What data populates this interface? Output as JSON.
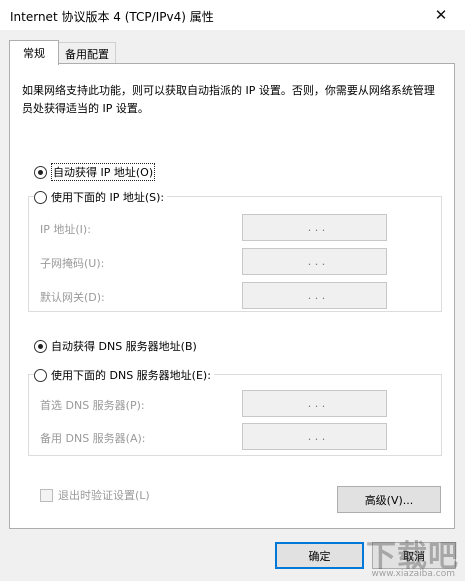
{
  "window": {
    "title": "Internet 协议版本 4 (TCP/IPv4) 属性",
    "close_glyph": "✕"
  },
  "tabs": [
    {
      "label": "常规",
      "active": true
    },
    {
      "label": "备用配置",
      "active": false
    }
  ],
  "description": "如果网络支持此功能，则可以获取自动指派的 IP 设置。否则，你需要从网络系统管理员处获得适当的 IP 设置。",
  "ip_section": {
    "auto_label": "自动获得 IP 地址(O)",
    "auto_checked": true,
    "manual_label": "使用下面的 IP 地址(S):",
    "manual_checked": false,
    "fields": [
      {
        "label": "IP 地址(I):",
        "value": ". . ."
      },
      {
        "label": "子网掩码(U):",
        "value": ". . ."
      },
      {
        "label": "默认网关(D):",
        "value": ". . ."
      }
    ]
  },
  "dns_section": {
    "auto_label": "自动获得 DNS 服务器地址(B)",
    "auto_checked": true,
    "manual_label": "使用下面的 DNS 服务器地址(E):",
    "manual_checked": false,
    "fields": [
      {
        "label": "首选 DNS 服务器(P):",
        "value": ". . ."
      },
      {
        "label": "备用 DNS 服务器(A):",
        "value": ". . ."
      }
    ]
  },
  "validate_on_exit": {
    "label": "退出时验证设置(L)",
    "checked": false
  },
  "buttons": {
    "advanced": "高级(V)...",
    "ok": "确定",
    "cancel": "取消"
  },
  "watermark": {
    "text": "下载吧",
    "sub": "www.xiazaiba.com"
  },
  "colors": {
    "default_button_border": "#0078d7",
    "disabled_text": "#9a9a9a"
  }
}
